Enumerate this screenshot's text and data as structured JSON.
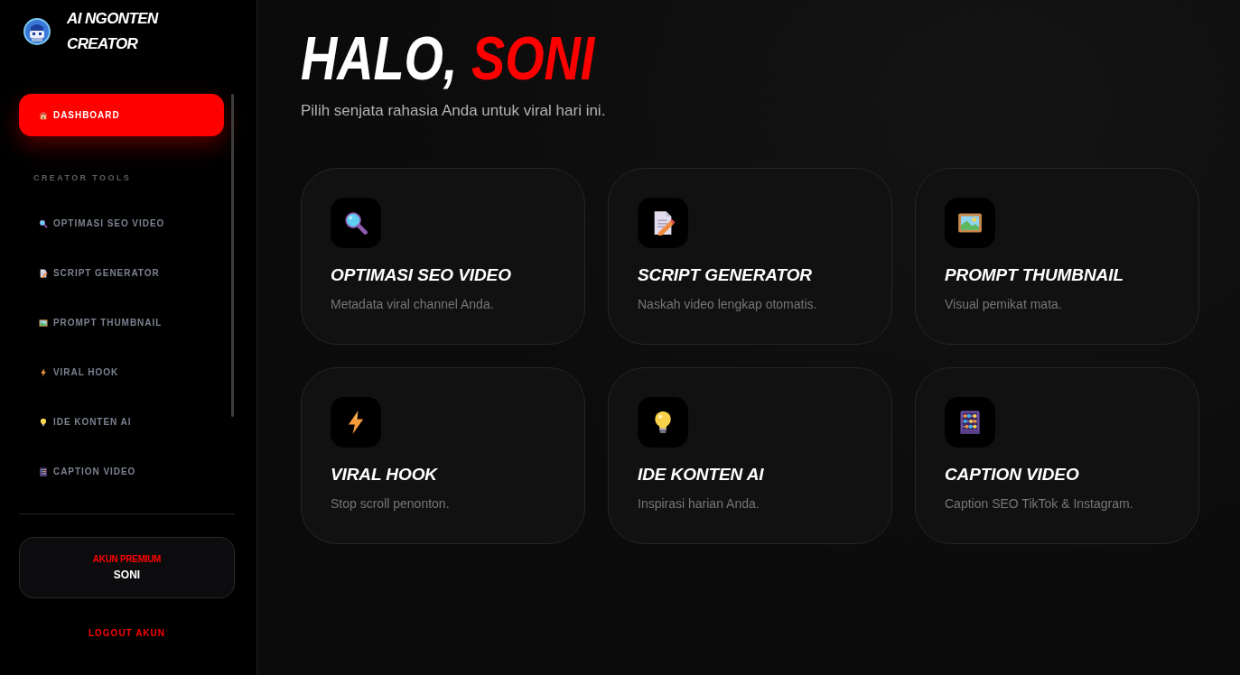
{
  "sidebar": {
    "brand": "AI NGONTEN CREATOR",
    "nav": [
      {
        "label": "DASHBOARD",
        "selected": true
      }
    ],
    "sections": [
      {
        "heading": "CREATOR TOOLS",
        "items": [
          {
            "label": "OPTIMASI SEO VIDEO",
            "selected": false
          },
          {
            "label": "SCRIPT GENERATOR",
            "selected": false
          },
          {
            "label": "PROMPT THUMBNAIL",
            "selected": false
          },
          {
            "label": "VIRAL HOOK",
            "selected": false
          },
          {
            "label": "IDE KONTEN AI",
            "selected": false
          },
          {
            "label": "CAPTION VIDEO",
            "selected": false
          }
        ]
      }
    ],
    "account": {
      "plan": "AKUN PREMIUM",
      "username": "SONI"
    },
    "logout": "LOGOUT AKUN"
  },
  "main": {
    "greeting": {
      "prefix": "HALO,",
      "name": "SONI"
    },
    "subtitle": "Pilih senjata rahasia Anda untuk viral hari ini.",
    "cards": [
      {
        "title": "OPTIMASI SEO VIDEO",
        "description": "Metadata viral channel Anda."
      },
      {
        "title": "SCRIPT GENERATOR",
        "description": "Naskah video lengkap otomatis."
      },
      {
        "title": "PROMPT THUMBNAIL",
        "description": "Visual pemikat mata."
      },
      {
        "title": "VIRAL HOOK",
        "description": "Stop scroll penonton."
      },
      {
        "title": "IDE KONTEN AI",
        "description": "Inspirasi harian Anda."
      },
      {
        "title": "CAPTION VIDEO",
        "description": "Caption SEO TikTok & Instagram."
      }
    ]
  }
}
